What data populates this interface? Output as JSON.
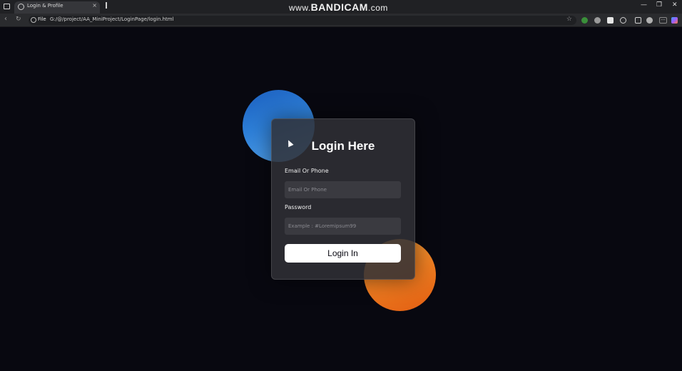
{
  "browser": {
    "tab_title": "Login & Profile",
    "tab_close": "×",
    "watermark_www": "www.",
    "watermark_brand": "BANDICAM",
    "watermark_tld": ".com",
    "url_prefix": "File",
    "url": "G:/@/project/AA_MiniProject/LoginPage/login.html",
    "star": "☆",
    "window_controls": {
      "minimize": "—",
      "restore": "❐",
      "close": "✕"
    }
  },
  "login": {
    "title": "Login Here",
    "email_label": "Email Or Phone",
    "email_placeholder": "Email Or Phone",
    "password_label": "Password",
    "password_placeholder": "Example : #Loremipsum99",
    "submit_label": "Login In"
  },
  "colors": {
    "background": "#080810",
    "circle_blue": "#2d7fd8",
    "circle_orange": "#ee7d21",
    "card": "#303036",
    "button": "#ffffff"
  }
}
